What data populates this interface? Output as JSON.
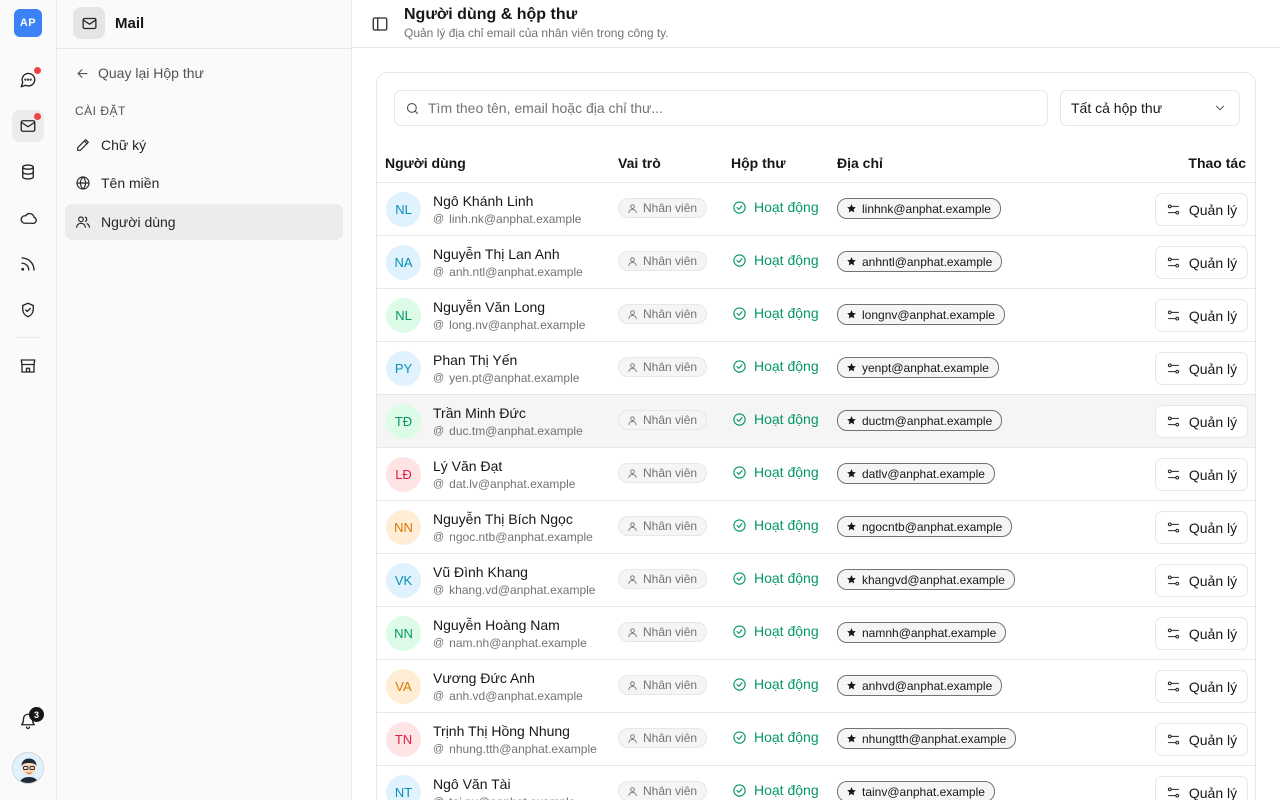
{
  "rail": {
    "logo_text": "AP",
    "notifications_count": "3"
  },
  "panel": {
    "title": "Mail",
    "back_label": "Quay lại Hộp thư",
    "section_label": "CÀI ĐẶT",
    "items": [
      {
        "label": "Chữ ký",
        "icon": "pen-icon"
      },
      {
        "label": "Tên miền",
        "icon": "globe-icon"
      },
      {
        "label": "Người dùng",
        "icon": "users-icon",
        "active": true
      }
    ]
  },
  "header": {
    "title": "Người dùng & hộp thư",
    "subtitle": "Quản lý địa chỉ email của nhân viên trong công ty."
  },
  "filters": {
    "search_placeholder": "Tìm theo tên, email hoặc địa chỉ thư...",
    "search_value": "",
    "mailbox_filter": "Tất cả hộp thư"
  },
  "table": {
    "columns": [
      "Người dùng",
      "Vai trò",
      "Hộp thư",
      "Địa chỉ",
      "Thao tác"
    ],
    "role_label": "Nhân viên",
    "status_label": "Hoạt động",
    "action_label": "Quản lý",
    "rows": [
      {
        "initials": "NL",
        "name": "Ngô Khánh Linh",
        "email": "linh.nk@anphat.example",
        "address": "linhnk@anphat.example",
        "color": "#0891b2",
        "bg": "#e0f2fe"
      },
      {
        "initials": "NA",
        "name": "Nguyễn Thị Lan Anh",
        "email": "anh.ntl@anphat.example",
        "address": "anhntl@anphat.example",
        "color": "#0891b2",
        "bg": "#e0f2fe"
      },
      {
        "initials": "NL",
        "name": "Nguyễn Văn Long",
        "email": "long.nv@anphat.example",
        "address": "longnv@anphat.example",
        "color": "#059669",
        "bg": "#dcfce7"
      },
      {
        "initials": "PY",
        "name": "Phan Thị Yến",
        "email": "yen.pt@anphat.example",
        "address": "yenpt@anphat.example",
        "color": "#0891b2",
        "bg": "#e0f2fe"
      },
      {
        "initials": "TĐ",
        "name": "Trần Minh Đức",
        "email": "duc.tm@anphat.example",
        "address": "ductm@anphat.example",
        "color": "#059669",
        "bg": "#dcfce7",
        "highlight": true
      },
      {
        "initials": "LĐ",
        "name": "Lý Văn Đạt",
        "email": "dat.lv@anphat.example",
        "address": "datlv@anphat.example",
        "color": "#e11d48",
        "bg": "#ffe4e6"
      },
      {
        "initials": "NN",
        "name": "Nguyễn Thị Bích Ngọc",
        "email": "ngoc.ntb@anphat.example",
        "address": "ngocntb@anphat.example",
        "color": "#d97706",
        "bg": "#ffedd5"
      },
      {
        "initials": "VK",
        "name": "Vũ Đình Khang",
        "email": "khang.vd@anphat.example",
        "address": "khangvd@anphat.example",
        "color": "#0891b2",
        "bg": "#e0f2fe"
      },
      {
        "initials": "NN",
        "name": "Nguyễn Hoàng Nam",
        "email": "nam.nh@anphat.example",
        "address": "namnh@anphat.example",
        "color": "#059669",
        "bg": "#dcfce7"
      },
      {
        "initials": "VA",
        "name": "Vương Đức Anh",
        "email": "anh.vd@anphat.example",
        "address": "anhvd@anphat.example",
        "color": "#d97706",
        "bg": "#ffedd5"
      },
      {
        "initials": "TN",
        "name": "Trịnh Thị Hồng Nhung",
        "email": "nhung.tth@anphat.example",
        "address": "nhungtth@anphat.example",
        "color": "#e11d48",
        "bg": "#ffe4e6"
      },
      {
        "initials": "NT",
        "name": "Ngô Văn Tài",
        "email": "tai.nv@anphat.example",
        "address": "tainv@anphat.example",
        "color": "#0891b2",
        "bg": "#e0f2fe"
      }
    ]
  }
}
